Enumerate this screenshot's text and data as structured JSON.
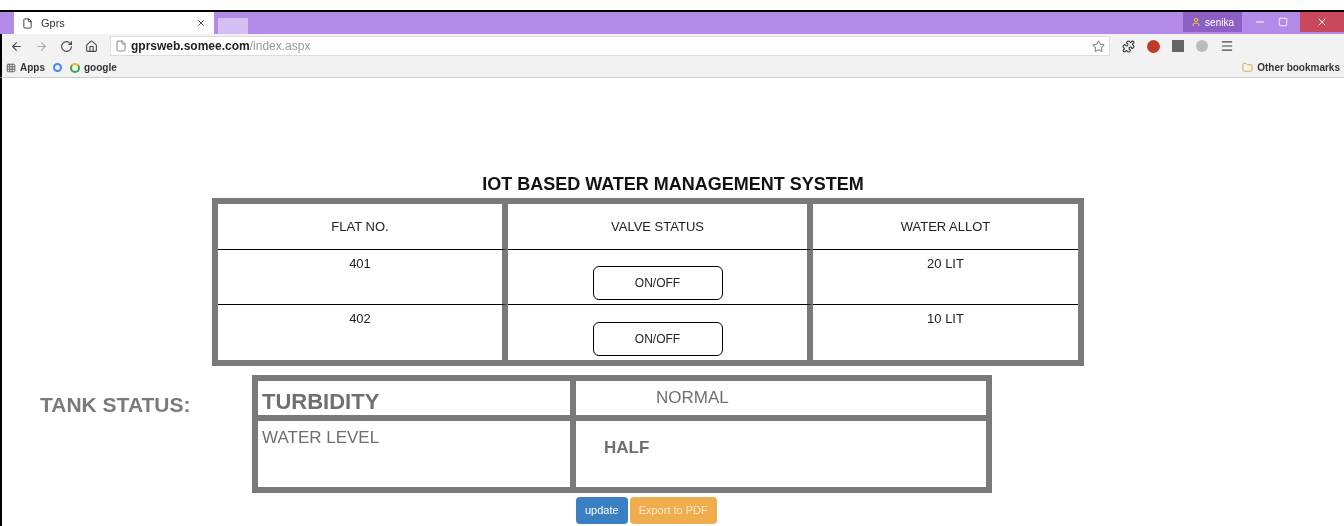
{
  "browser": {
    "tab_title": "Gprs",
    "url_domain": "gprsweb.somee.com",
    "url_path": "/index.aspx",
    "user": "senika",
    "bookmarks": [
      "Apps",
      "google"
    ],
    "other_bookmarks": "Other bookmarks"
  },
  "page": {
    "title": "IOT BASED WATER MANAGEMENT SYSTEM",
    "table": {
      "columns": [
        "FLAT NO.",
        "VALVE STATUS",
        "WATER ALLOT"
      ],
      "rows": [
        {
          "flat": "401",
          "valve": "ON/OFF",
          "allot": "20 LIT"
        },
        {
          "flat": "402",
          "valve": "ON/OFF",
          "allot": "10 LIT"
        }
      ]
    },
    "tank_label": "TANK STATUS:",
    "tank_rows": [
      {
        "label": "TURBIDITY",
        "value": "NORMAL",
        "bold": true
      },
      {
        "label": "WATER LEVEL",
        "value": "HALF",
        "bold": false
      }
    ],
    "buttons": [
      {
        "label": "update",
        "kind": "primary"
      },
      {
        "label": "Export to PDF",
        "kind": "warning"
      }
    ]
  }
}
